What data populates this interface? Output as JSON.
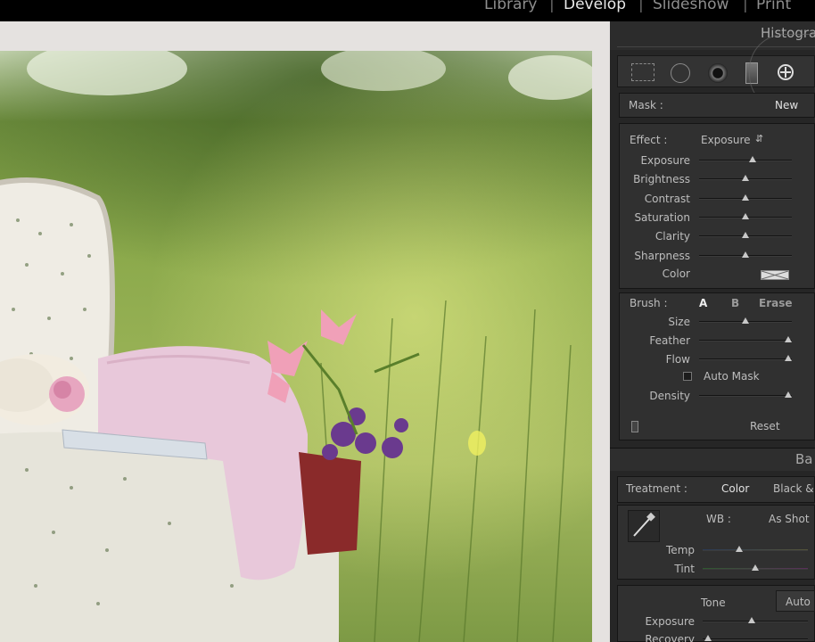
{
  "modules": [
    "Library",
    "Develop",
    "Slideshow",
    "Print"
  ],
  "active_module": "Develop",
  "histogram_title": "Histogra",
  "mask": {
    "label": "Mask :",
    "new_label": "New"
  },
  "effect": {
    "label": "Effect :",
    "preset": "Exposure"
  },
  "adjust_sliders": [
    {
      "label": "Exposure",
      "value": 0.58
    },
    {
      "label": "Brightness",
      "value": 0.5
    },
    {
      "label": "Contrast",
      "value": 0.5
    },
    {
      "label": "Saturation",
      "value": 0.5
    },
    {
      "label": "Clarity",
      "value": 0.5
    },
    {
      "label": "Sharpness",
      "value": 0.5
    }
  ],
  "color_label": "Color",
  "brush": {
    "label": "Brush :",
    "a": "A",
    "b": "B",
    "erase": "Erase"
  },
  "brush_sliders": [
    {
      "label": "Size",
      "value": 0.5
    },
    {
      "label": "Feather",
      "value": 0.96
    },
    {
      "label": "Flow",
      "value": 0.96
    }
  ],
  "auto_mask": "Auto Mask",
  "density": {
    "label": "Density",
    "value": 0.96
  },
  "reset_label": "Reset",
  "basic_title": "Ba",
  "treatment": {
    "label": "Treatment :",
    "color": "Color",
    "bw": "Black &"
  },
  "wb": {
    "label": "WB :",
    "value": "As Shot"
  },
  "wb_sliders": [
    {
      "label": "Temp",
      "value": 0.35
    },
    {
      "label": "Tint",
      "value": 0.5
    }
  ],
  "tone": {
    "label": "Tone",
    "auto": "Auto"
  },
  "tone_sliders": [
    {
      "label": "Exposure",
      "value": 0.47
    },
    {
      "label": "Recovery",
      "value": 0.05
    }
  ]
}
